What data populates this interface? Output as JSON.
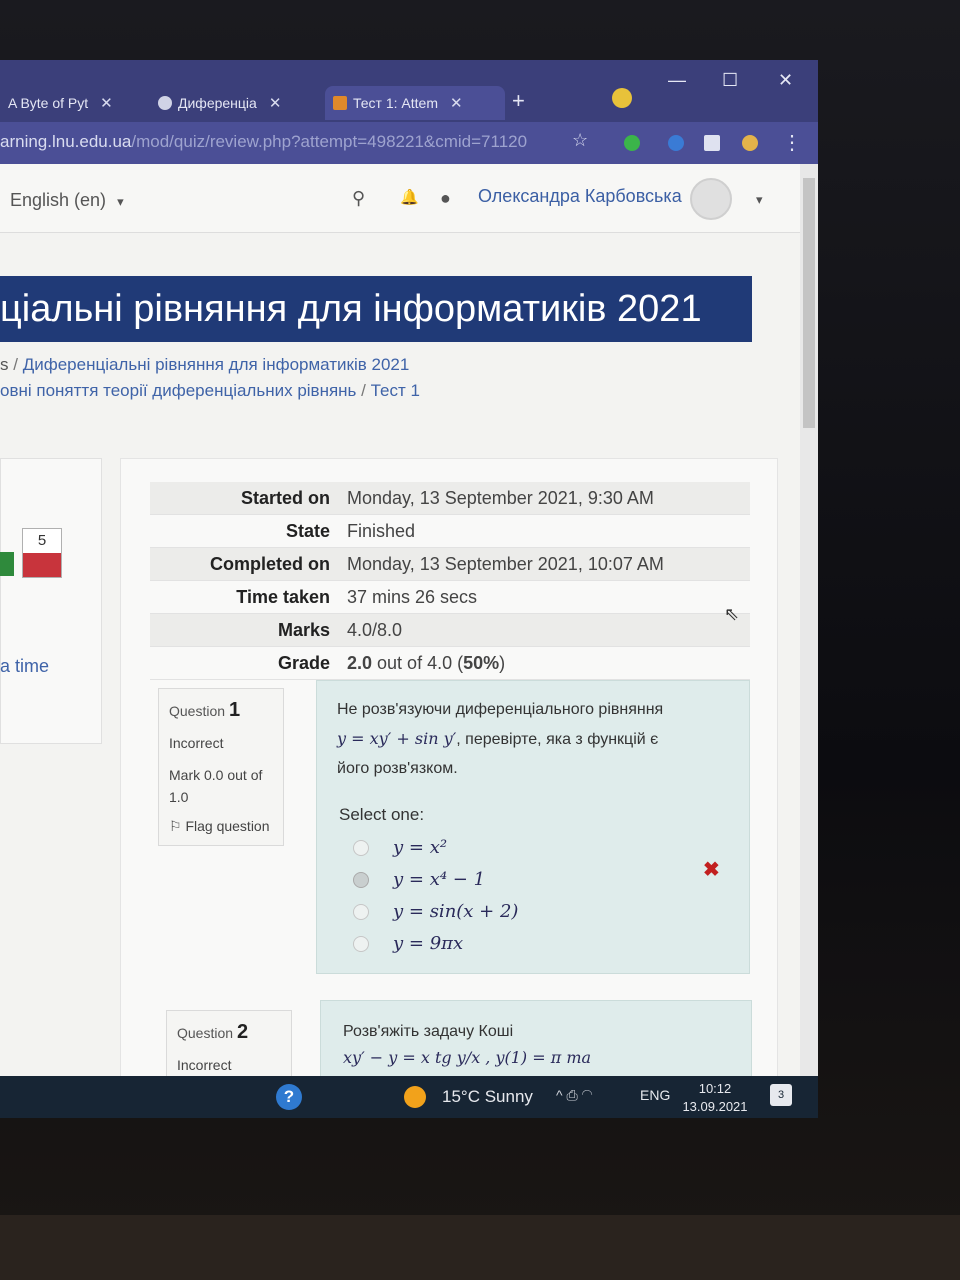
{
  "browser": {
    "tabs": [
      {
        "label": "A Byte of Pyt",
        "close": "✕"
      },
      {
        "label": "Диференціа",
        "close": "✕"
      },
      {
        "label": "Тест 1: Attem",
        "close": "✕"
      }
    ],
    "new_tab": "+",
    "window_controls": {
      "minimize": "—",
      "maximize": "☐",
      "close": "✕"
    },
    "url_host": "arning.lnu.edu.ua",
    "url_path": "/mod/quiz/review.php?attempt=498221&cmid=71120",
    "bookmark_star": "☆",
    "menu_dots": "⋮"
  },
  "navbar": {
    "language": "English (en)",
    "language_caret": "▾",
    "search_icon": "⚲",
    "bell_icon": "🔔",
    "chat_icon": "●",
    "user_name": "Олександра Карбовська",
    "user_caret": "▾"
  },
  "course": {
    "title": "ціальні рівняння для інформатиків 2021",
    "breadcrumb_line1_prefix": "s",
    "breadcrumb_sep": "/",
    "breadcrumb_course": "Диференціальні рівняння для інформатиків 2021",
    "breadcrumb_line2_section": "овні поняття теорії диференціальних рівнянь",
    "breadcrumb_quiz": "Тест 1"
  },
  "quiz_nav": {
    "question_number": "5",
    "link": "a time"
  },
  "summary": {
    "rows": [
      {
        "label": "Started on",
        "value": "Monday, 13 September 2021, 9:30 AM"
      },
      {
        "label": "State",
        "value": "Finished"
      },
      {
        "label": "Completed on",
        "value": "Monday, 13 September 2021, 10:07 AM"
      },
      {
        "label": "Time taken",
        "value": "37 mins 26 secs"
      },
      {
        "label": "Marks",
        "value": "4.0/8.0"
      }
    ],
    "grade_label": "Grade",
    "grade_value": "2.0",
    "grade_rest": " out of 4.0 (",
    "grade_percent": "50%",
    "grade_close": ")"
  },
  "question1": {
    "label": "Question",
    "number": "1",
    "status": "Incorrect",
    "mark": "Mark 0.0 out of 1.0",
    "flag": "Flag question",
    "text_line1": "Не розв'язуючи диференціального рівняння",
    "equation": "y = xy′ + sin y′",
    "text_line2": ", перевірте, яка з функцій є",
    "text_line3": "його розв'язком.",
    "select_label": "Select one:",
    "options": [
      "y = x²",
      "y = x⁴ − 1",
      "y = sin(x + 2)",
      "y = 9πx"
    ],
    "wrong_mark": "✖"
  },
  "question2": {
    "label": "Question",
    "number": "2",
    "status": "Incorrect",
    "text_line1": "Розв'яжіть задачу Коші",
    "text_line2": "xy′ − y = x tg y/x ,  y(1) = π та"
  },
  "taskbar": {
    "help": "?",
    "weather": "15°C  Sunny",
    "tray": "^ ⎙ ◠",
    "language": "ENG",
    "time": "10:12",
    "date": "13.09.2021",
    "notifications": "3"
  }
}
